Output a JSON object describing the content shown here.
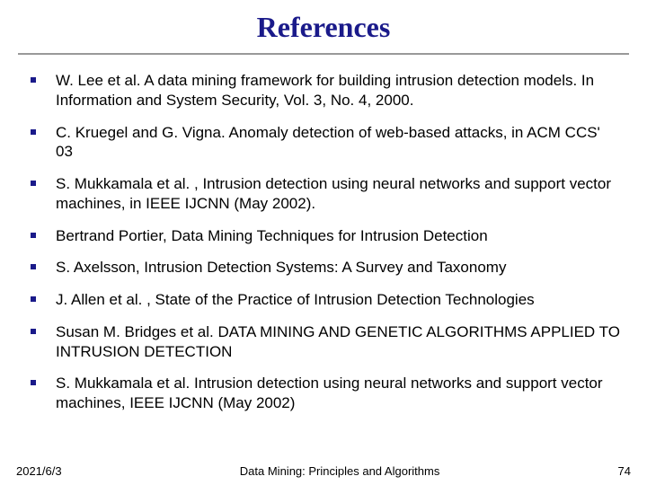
{
  "title": "References",
  "references": [
    "W. Lee et al. A data mining framework for building intrusion detection models. In Information and System Security, Vol. 3, No. 4, 2000.",
    "C. Kruegel and G. Vigna.  Anomaly detection of web-based attacks, in ACM CCS' 03",
    "S. Mukkamala et al. , Intrusion detection using neural networks and support vector machines, in IEEE IJCNN (May 2002).",
    "Bertrand Portier, Data Mining Techniques for Intrusion Detection",
    "S. Axelsson, Intrusion Detection Systems: A Survey and Taxonomy",
    "J. Allen et al. , State of the Practice of Intrusion Detection Technologies",
    "Susan M. Bridges et al. DATA MINING AND GENETIC ALGORITHMS APPLIED TO INTRUSION DETECTION",
    "S. Mukkamala et al. Intrusion detection using neural networks and support vector machines, IEEE IJCNN (May 2002)"
  ],
  "footer": {
    "date": "2021/6/3",
    "center": "Data Mining: Principles and Algorithms",
    "page": "74"
  }
}
